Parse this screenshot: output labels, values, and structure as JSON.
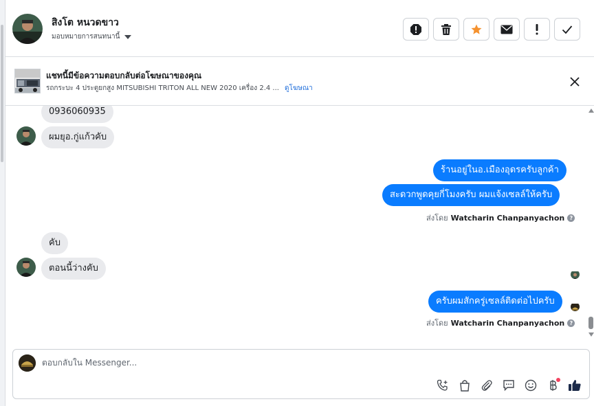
{
  "header": {
    "contact_name": "สิงโต หนวดขาว",
    "assign_label": "มอบหมายการสนทนานี้",
    "actions": [
      {
        "name": "spam-icon"
      },
      {
        "name": "trash-icon"
      },
      {
        "name": "star-icon"
      },
      {
        "name": "mail-icon"
      },
      {
        "name": "exclamation-icon"
      },
      {
        "name": "check-icon"
      }
    ]
  },
  "ad": {
    "title": "แชทนี้มีข้อความตอบกลับต่อโฆษณาของคุณ",
    "subtitle": "รถกระบะ 4 ประตูยกสูง MITSUBISHI TRITON ALL NEW 2020 เครื่อง 2.4 ...",
    "link_label": "ดูโฆษณา"
  },
  "messages": {
    "in_1": "0936060935",
    "in_2": "ผมยุอ.กู่แก้วคับ",
    "out_1": "ร้านอยู่ในอ.เมืองอุดรครับลูกค้า",
    "out_2": "สะดวกพูดคุยกี่โมงครับ ผมแจ้งเซลล์ให้ครับ",
    "sent_by_prefix": "ส่งโดย",
    "sent_by_name": "Watcharin Chanpanyachon",
    "in_3": "คับ",
    "in_4": "ตอนนี้ว่างคับ",
    "out_3": "ครับผมสักครู่เซลล์ติดต่อไปครับ",
    "sent_by_prefix_2": "ส่งโดย",
    "sent_by_name_2": "Watcharin Chanpanyachon"
  },
  "composer": {
    "placeholder": "ตอบกลับใน Messenger..."
  },
  "colors": {
    "outgoing_bubble": "#0a7cff",
    "incoming_bubble": "#e9eaed",
    "star": "#f5922f",
    "link": "#216fdb",
    "like": "#1c2b4a",
    "notification_dot": "#f3425f"
  }
}
